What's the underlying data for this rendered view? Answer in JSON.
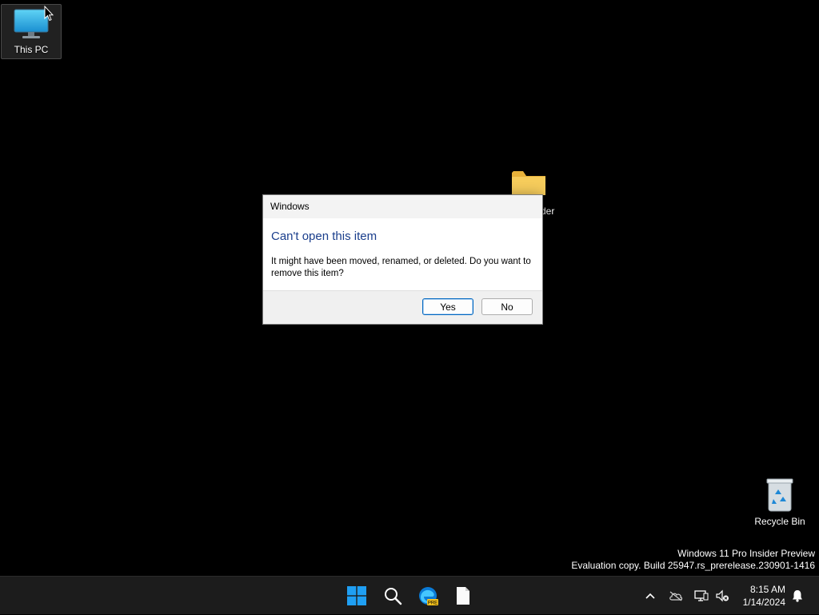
{
  "desktop": {
    "icons": [
      {
        "label": "This PC",
        "icon": "monitor-icon"
      },
      {
        "label": "der",
        "icon": "folder-icon"
      },
      {
        "label": "Recycle Bin",
        "icon": "recycle-bin-icon"
      }
    ],
    "watermark": {
      "line1": "Windows 11 Pro Insider Preview",
      "line2": "Evaluation copy. Build 25947.rs_prerelease.230901-1416"
    }
  },
  "dialog": {
    "title": "Windows",
    "heading": "Can't open this item",
    "message": "It might have been moved, renamed, or deleted. Do you want to remove this item?",
    "yes_label": "Yes",
    "no_label": "No"
  },
  "taskbar": {
    "apps": [
      {
        "name": "start",
        "icon": "windows-logo-icon"
      },
      {
        "name": "search",
        "icon": "search-icon"
      },
      {
        "name": "edge",
        "icon": "edge-icon",
        "badge": "PRE"
      },
      {
        "name": "file",
        "icon": "document-icon"
      }
    ],
    "tray_icons": [
      "chevron-up-icon",
      "cloud-off-icon",
      "network-icon",
      "volume-muted-icon"
    ],
    "time": "8:15 AM",
    "date": "1/14/2024"
  },
  "colors": {
    "accent": "#0067c0",
    "heading": "#1a3e8c",
    "taskbar": "#1c1c1c"
  }
}
